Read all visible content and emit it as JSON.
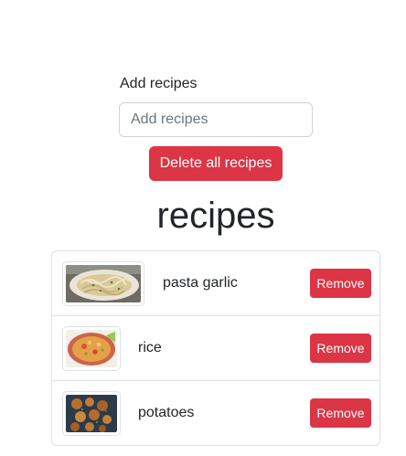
{
  "form": {
    "label": "Add recipes",
    "input_placeholder": "Add recipes",
    "input_value": "",
    "delete_all_label": "Delete all recipes"
  },
  "heading": "recipes",
  "recipes": [
    {
      "name": "pasta garlic",
      "image": "pasta-dish-image",
      "remove_label": "Remove"
    },
    {
      "name": "rice",
      "image": "rice-dish-image",
      "remove_label": "Remove"
    },
    {
      "name": "potatoes",
      "image": "potatoes-dish-image",
      "remove_label": "Remove"
    }
  ],
  "colors": {
    "danger": "#dc3545",
    "border": "#dee2e6",
    "text": "#212529",
    "placeholder": "#6c757d"
  }
}
